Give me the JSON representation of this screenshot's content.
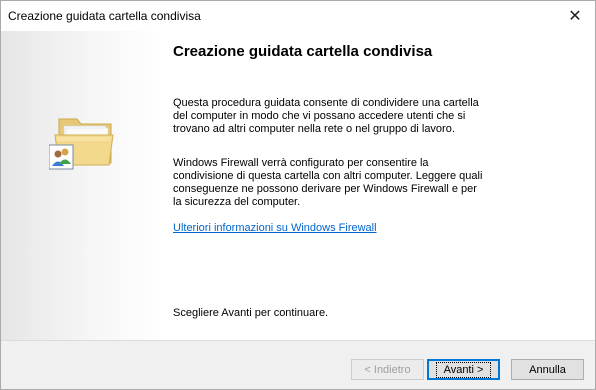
{
  "window": {
    "title": "Creazione guidata cartella condivisa",
    "close_glyph": "✕"
  },
  "content": {
    "heading": "Creazione guidata cartella condivisa",
    "paragraph1": "Questa procedura guidata consente di condividere una cartella del computer in modo che vi possano accedere utenti che si trovano ad altri computer nella rete o nel gruppo di lavoro.",
    "paragraph2": "Windows Firewall verrà configurato per consentire la condivisione di questa cartella con altri computer. Leggere quali conseguenze ne possono derivare per Windows Firewall e per la sicurezza del computer.",
    "link": "Ulteriori informazioni su Windows Firewall",
    "footer": "Scegliere Avanti per continuare."
  },
  "sidebar": {
    "icon": "shared-folder-icon"
  },
  "buttons": {
    "back": "< Indietro",
    "next": "Avanti >",
    "cancel": "Annulla"
  }
}
